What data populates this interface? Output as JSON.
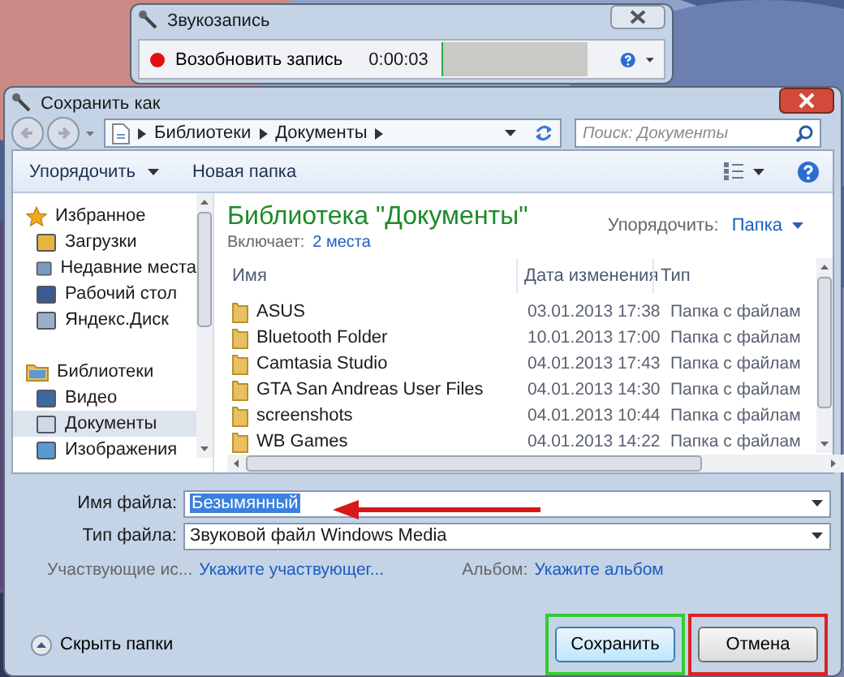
{
  "recorder": {
    "title": "Звукозапись",
    "record_button": "Возобновить запись",
    "time": "0:00:03",
    "level": 0.01
  },
  "dialog": {
    "title": "Сохранить как",
    "breadcrumb": [
      "Библиотеки",
      "Документы"
    ],
    "search": {
      "placeholder": "Поиск: Документы"
    },
    "toolbar": [
      {
        "label": "Упорядочить",
        "kind": "menu"
      },
      {
        "label": "Новая папка",
        "kind": "button"
      }
    ],
    "sidebar": [
      {
        "label": "Избранное",
        "children": [
          {
            "label": "Загрузки",
            "selected": false
          },
          {
            "label": "Недавние места",
            "selected": false
          },
          {
            "label": "Рабочий стол",
            "selected": false
          },
          {
            "label": "Яндекс.Диск",
            "selected": false
          }
        ]
      },
      {
        "label": "Библиотеки",
        "children": [
          {
            "label": "Видео",
            "selected": false
          },
          {
            "label": "Документы",
            "selected": true
          },
          {
            "label": "Изображения",
            "selected": false
          }
        ]
      }
    ]
  },
  "library": {
    "title": "Библиотека \"Документы\"",
    "includes_label": "Включает:",
    "includes_link": "2 места",
    "arrange_label": "Упорядочить:",
    "arrange_value": "Папка"
  },
  "table": {
    "columns": [
      "Имя",
      "Дата изменения",
      "Тип"
    ],
    "rows": [
      {
        "name": "ASUS",
        "date": "03.01.2013 17:38",
        "type": "Папка с файлам"
      },
      {
        "name": "Bluetooth Folder",
        "date": "10.01.2013 17:00",
        "type": "Папка с файлам"
      },
      {
        "name": "Camtasia Studio",
        "date": "04.01.2013 17:43",
        "type": "Папка с файлам"
      },
      {
        "name": "GTA San Andreas User Files",
        "date": "04.01.2013 14:30",
        "type": "Папка с файлам"
      },
      {
        "name": "screenshots",
        "date": "04.01.2013 10:44",
        "type": "Папка с файлам"
      },
      {
        "name": "WB Games",
        "date": "04.01.2013 14:22",
        "type": "Папка с файлам"
      }
    ]
  },
  "form": {
    "file_name_label": "Имя файла:",
    "file_name": "Безымянный",
    "file_type_label": "Тип файла:",
    "file_type": "Звуковой файл Windows Media",
    "meta": [
      {
        "label": "Участвующие ис...",
        "value": "Укажите участвующег..."
      },
      {
        "label": "Альбом:",
        "value": "Укажите альбом"
      }
    ]
  },
  "hide_folders": "Скрыть папки",
  "buttons": [
    {
      "label": "Сохранить",
      "color": "#33cc33"
    },
    {
      "label": "Отмена",
      "color": "#dd2222"
    }
  ]
}
